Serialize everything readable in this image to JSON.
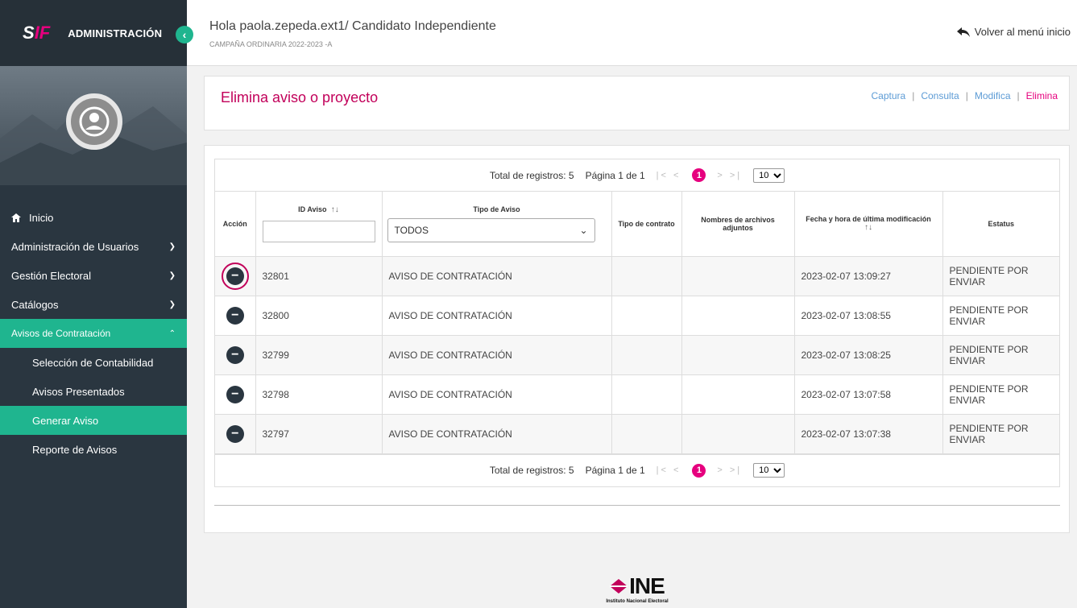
{
  "sidebar": {
    "brand_title": "ADMINISTRACIÓN",
    "logo_s": "S",
    "logo_f": "IF",
    "items": [
      {
        "label": "Inicio"
      },
      {
        "label": "Administración de Usuarios"
      },
      {
        "label": "Gestión Electoral"
      },
      {
        "label": "Catálogos"
      },
      {
        "label": "Avisos de Contratación"
      }
    ],
    "sub_items": [
      {
        "label": "Selección de Contabilidad"
      },
      {
        "label": "Avisos Presentados"
      },
      {
        "label": "Generar Aviso"
      },
      {
        "label": "Reporte de Avisos"
      }
    ]
  },
  "header": {
    "greeting": "Hola paola.zepeda.ext1/ Candidato Independiente",
    "campaign": "CAMPAÑA ORDINARIA 2022-2023 -A",
    "back_label": "Volver al menú inicio"
  },
  "page": {
    "title": "Elimina aviso o proyecto",
    "breadcrumb": [
      "Captura",
      "Consulta",
      "Modifica",
      "Elimina"
    ]
  },
  "pager": {
    "total": "Total de registros: 5",
    "page": "Página 1 de 1",
    "current": "1",
    "per_page": "10"
  },
  "table": {
    "headers": {
      "accion": "Acción",
      "id": "ID Aviso",
      "tipo_aviso": "Tipo de Aviso",
      "tipo_contrato": "Tipo de contrato",
      "archivos": "Nombres de archivos adjuntos",
      "fecha": "Fecha y hora de última modificación",
      "estatus": "Estatus"
    },
    "tipo_filter": "TODOS",
    "rows": [
      {
        "id": "32801",
        "tipo": "AVISO DE CONTRATACIÓN",
        "fecha": "2023-02-07 13:09:27",
        "estatus": "PENDIENTE POR ENVIAR"
      },
      {
        "id": "32800",
        "tipo": "AVISO DE CONTRATACIÓN",
        "fecha": "2023-02-07 13:08:55",
        "estatus": "PENDIENTE POR ENVIAR"
      },
      {
        "id": "32799",
        "tipo": "AVISO DE CONTRATACIÓN",
        "fecha": "2023-02-07 13:08:25",
        "estatus": "PENDIENTE POR ENVIAR"
      },
      {
        "id": "32798",
        "tipo": "AVISO DE CONTRATACIÓN",
        "fecha": "2023-02-07 13:07:58",
        "estatus": "PENDIENTE POR ENVIAR"
      },
      {
        "id": "32797",
        "tipo": "AVISO DE CONTRATACIÓN",
        "fecha": "2023-02-07 13:07:38",
        "estatus": "PENDIENTE POR ENVIAR"
      }
    ]
  },
  "footer": {
    "logo_text": "INE",
    "logo_sub": "Instituto Nacional Electoral"
  },
  "colors": {
    "accent": "#1fb58f",
    "brand": "#e6007e",
    "sidebar": "#2a3640"
  }
}
